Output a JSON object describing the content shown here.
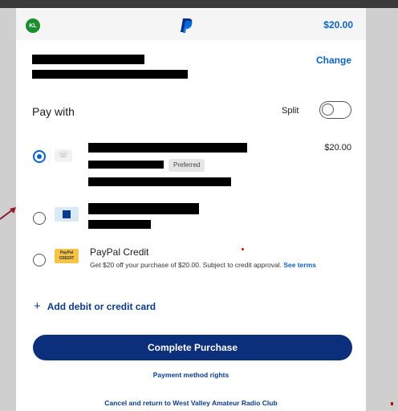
{
  "header": {
    "avatar_initials": "KL",
    "amount": "$20.00"
  },
  "address": {
    "change_label": "Change"
  },
  "pay_with": {
    "label": "Pay with",
    "split_label": "Split"
  },
  "methods": {
    "bank": {
      "amount": "$20.00",
      "preferred_badge": "Preferred"
    },
    "credit": {
      "title": "PayPal Credit",
      "description": "Get $20 off your purchase of $20.00. Subject to credit approval.",
      "terms_link": "See terms",
      "icon_text": "PayPal CREDIT"
    }
  },
  "add_card": {
    "label": "Add debit or credit card",
    "icon": "+"
  },
  "actions": {
    "complete_label": "Complete Purchase",
    "payment_rights_label": "Payment method rights",
    "cancel_label": "Cancel and return to West Valley Amateur Radio Club"
  },
  "colors": {
    "accent": "#0b63c5",
    "button": "#0b2f7a",
    "avatar": "#1a8f2e"
  }
}
